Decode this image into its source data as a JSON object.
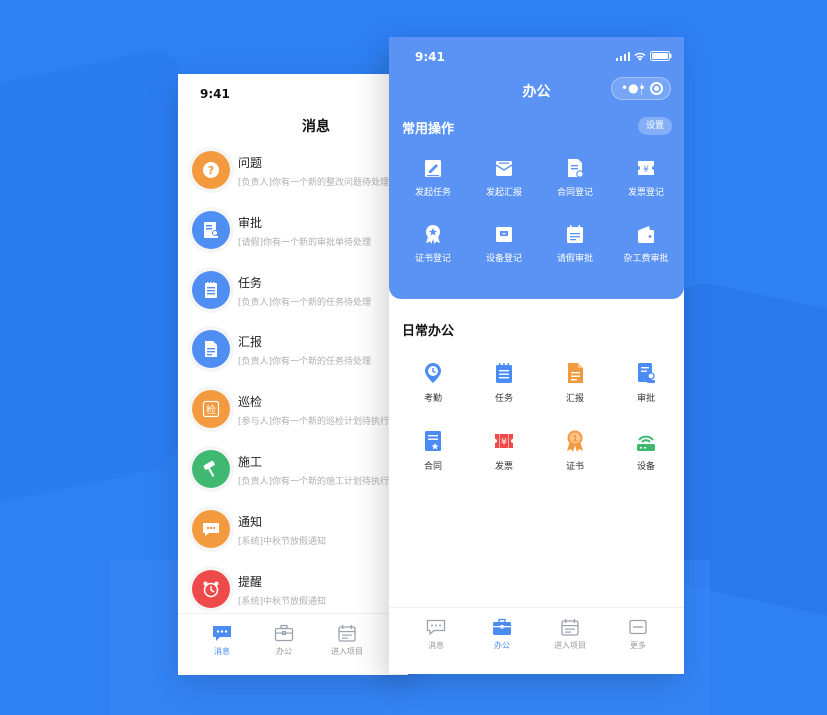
{
  "colors": {
    "accent": "#4a8cf3",
    "header_blue": "#5b93f4",
    "background": "#2f80f5"
  },
  "left_phone": {
    "time": "9:41",
    "title": "消息",
    "messages": [
      {
        "title": "问题",
        "subtitle": "[负责人]你有一个新的整改问题待处理",
        "icon": "question-icon",
        "color": "#f39a3e"
      },
      {
        "title": "审批",
        "subtitle": "[请假]你有一个新的审批单待处理",
        "icon": "approval-icon",
        "color": "#4f8ef3"
      },
      {
        "title": "任务",
        "subtitle": "[负责人]你有一个新的任务待处理",
        "icon": "task-icon",
        "color": "#4f8ef3"
      },
      {
        "title": "汇报",
        "subtitle": "[负责人]你有一个新的任务待处理",
        "icon": "report-icon",
        "color": "#4f8ef3"
      },
      {
        "title": "巡检",
        "subtitle": "[参与人]你有一个新的巡检计划待执行",
        "icon": "inspection-icon",
        "color": "#f39a3e",
        "badge": "检"
      },
      {
        "title": "施工",
        "subtitle": "[负责人]你有一个新的施工计划待执行",
        "icon": "construction-icon",
        "color": "#3fb971"
      },
      {
        "title": "通知",
        "subtitle": "[系统]中秋节放假通知",
        "icon": "notice-icon",
        "color": "#f39a3e"
      },
      {
        "title": "提醒",
        "subtitle": "[系统]中秋节放假通知",
        "icon": "alarm-clock-icon",
        "color": "#ef4a4a"
      }
    ],
    "tabbar": [
      {
        "label": "消息",
        "icon": "message-icon",
        "active": true
      },
      {
        "label": "办公",
        "icon": "briefcase-icon",
        "active": false
      },
      {
        "label": "进入项目",
        "icon": "calendar-icon",
        "active": false
      }
    ]
  },
  "right_phone": {
    "time": "9:41",
    "title": "办公",
    "common_section": {
      "title": "常用操作",
      "settings_label": "设置",
      "items": [
        {
          "label": "发起任务",
          "icon": "edit-task-icon"
        },
        {
          "label": "发起汇报",
          "icon": "report-mail-icon"
        },
        {
          "label": "合同登记",
          "icon": "contract-register-icon"
        },
        {
          "label": "发票登记",
          "icon": "invoice-icon"
        },
        {
          "label": "证书登记",
          "icon": "certificate-icon"
        },
        {
          "label": "设备登记",
          "icon": "device-register-icon"
        },
        {
          "label": "请假审批",
          "icon": "leave-approval-icon"
        },
        {
          "label": "杂工费审批",
          "icon": "wallet-icon"
        }
      ]
    },
    "daily_section": {
      "title": "日常办公",
      "items": [
        {
          "label": "考勤",
          "icon": "attendance-pin-icon",
          "color": "#4a8cf3"
        },
        {
          "label": "任务",
          "icon": "task-list-icon",
          "color": "#4a8cf3"
        },
        {
          "label": "汇报",
          "icon": "report-doc-icon",
          "color": "#f39a3e"
        },
        {
          "label": "审批",
          "icon": "approval-doc-icon",
          "color": "#4a8cf3"
        },
        {
          "label": "合同",
          "icon": "contract-icon",
          "color": "#4a8cf3"
        },
        {
          "label": "发票",
          "icon": "invoice-ticket-icon",
          "color": "#ef4a4a",
          "glyph": "¥"
        },
        {
          "label": "证书",
          "icon": "medal-icon",
          "color": "#f39a3e",
          "glyph": "1"
        },
        {
          "label": "设备",
          "icon": "router-icon",
          "color": "#3fb971"
        }
      ]
    },
    "tabbar": [
      {
        "label": "消息",
        "icon": "message-icon",
        "active": false
      },
      {
        "label": "办公",
        "icon": "briefcase-icon",
        "active": true
      },
      {
        "label": "进入项目",
        "icon": "calendar-icon",
        "active": false
      },
      {
        "label": "更多",
        "icon": "more-icon",
        "active": false
      }
    ]
  }
}
